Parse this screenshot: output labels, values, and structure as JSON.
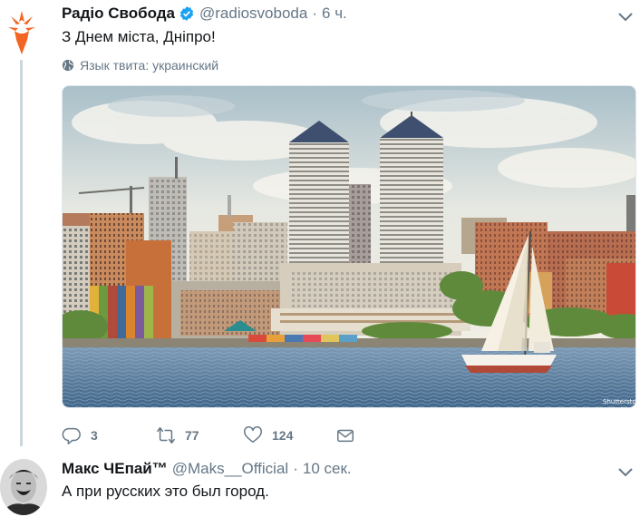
{
  "tweet1": {
    "author_name": "Радіо Свобода",
    "handle": "@radiosvoboda",
    "separator": "·",
    "time": "6 ч.",
    "text": "З Днем міста, Дніпро!",
    "language_label": "Язык твита: украинский",
    "photo_watermark": "Shutterstock",
    "actions": {
      "replies": "3",
      "retweets": "77",
      "likes": "124"
    }
  },
  "tweet2": {
    "author_name": "Макс ЧЕпай™",
    "handle": "@Maks__Official",
    "separator": "·",
    "time": "10 сек.",
    "text": "А при русских это был город."
  },
  "icons": [
    "rfe-logo",
    "verified-icon",
    "chevron-down-icon",
    "globe-icon",
    "reply-icon",
    "retweet-icon",
    "like-icon",
    "share-icon"
  ],
  "colors": {
    "verified": "#1da1f2",
    "rfe_orange": "#f26522",
    "muted": "#657786",
    "thread_line": "#ccd6dd"
  }
}
